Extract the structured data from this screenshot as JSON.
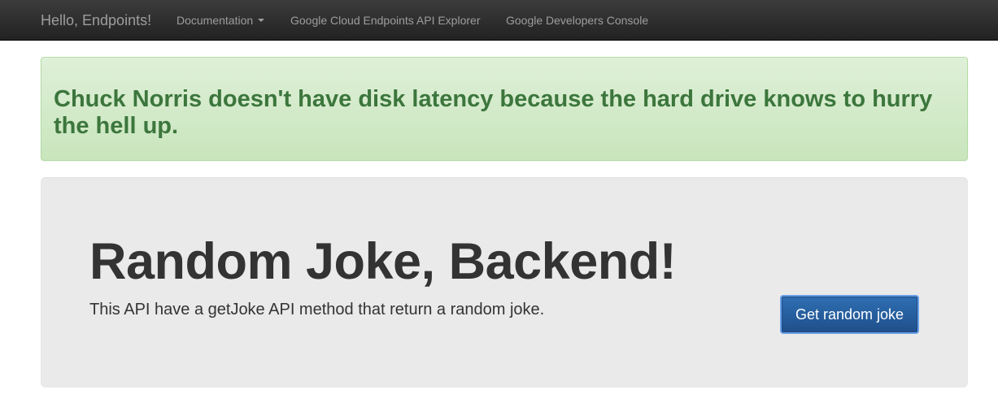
{
  "navbar": {
    "brand": "Hello, Endpoints!",
    "items": [
      {
        "label": "Documentation",
        "has_dropdown": true
      },
      {
        "label": "Google Cloud Endpoints API Explorer"
      },
      {
        "label": "Google Developers Console"
      }
    ],
    "background_color": "#222222"
  },
  "alert": {
    "message": "Chuck Norris doesn't have disk latency because the hard drive knows to hurry the hell up.",
    "color": "#3c763d",
    "background_color": "#dff0d8"
  },
  "jumbotron": {
    "title": "Random Joke, Backend!",
    "description": "This API have a getJoke API method that return a random joke.",
    "button_label": "Get random joke",
    "button_color": "#2e6fb3",
    "background_color": "#eaeaea"
  }
}
